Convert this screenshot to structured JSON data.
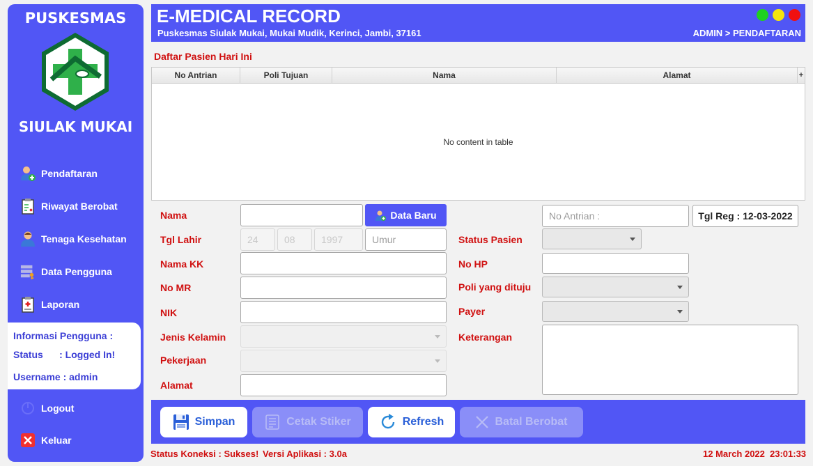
{
  "sidebar": {
    "brand_top": "PUSKESMAS",
    "brand_bottom": "SIULAK MUKAI",
    "items": [
      {
        "label": "Pendaftaran"
      },
      {
        "label": "Riwayat Berobat"
      },
      {
        "label": "Tenaga Kesehatan"
      },
      {
        "label": "Data Pengguna"
      },
      {
        "label": "Laporan"
      }
    ],
    "user_info": {
      "title": "Informasi Pengguna :",
      "status": "Status      : Logged In!",
      "username": "Username : admin"
    },
    "logout_label": "Logout",
    "exit_label": "Keluar"
  },
  "header": {
    "title": "E-MEDICAL RECORD",
    "subtitle": "Puskesmas Siulak Mukai, Mukai Mudik, Kerinci, Jambi, 37161",
    "breadcrumb": "ADMIN > PENDAFTARAN",
    "window_dots": [
      "#1fd11f",
      "#f5e50c",
      "#f01010"
    ]
  },
  "table": {
    "caption": "Daftar  Pasien Hari Ini",
    "columns": [
      "No Antrian",
      "Poli Tujuan",
      "Nama",
      "Alamat"
    ],
    "menu_glyph": "+",
    "empty_text": "No content in table"
  },
  "form": {
    "nama_label": "Nama",
    "tgl_lahir_label": "Tgl Lahir",
    "nama_kk_label": "Nama KK",
    "no_mr_label": "No MR",
    "nik_label": "NIK",
    "jenis_kelamin_label": "Jenis Kelamin",
    "pekerjaan_label": "Pekerjaan",
    "alamat_label": "Alamat",
    "data_baru_label": "Data Baru",
    "tgl_day": "24",
    "tgl_month": "08",
    "tgl_year": "1997",
    "umur_placeholder": "Umur",
    "no_antrian_placeholder": "No Antrian :",
    "tgl_reg": "Tgl Reg : 12-03-2022",
    "status_pasien_label": "Status Pasien",
    "no_hp_label": "No HP",
    "poli_label": "Poli yang dituju",
    "payer_label": "Payer",
    "keterangan_label": "Keterangan"
  },
  "actions": {
    "simpan": "Simpan",
    "cetak": "Cetak Stiker",
    "refresh": "Refresh",
    "batal": "Batal Berobat"
  },
  "statusbar": {
    "koneksi": "Status Koneksi : Sukses!",
    "versi": "Versi Aplikasi : 3.0a",
    "date": "12 March 2022",
    "time": "23:01:33"
  }
}
